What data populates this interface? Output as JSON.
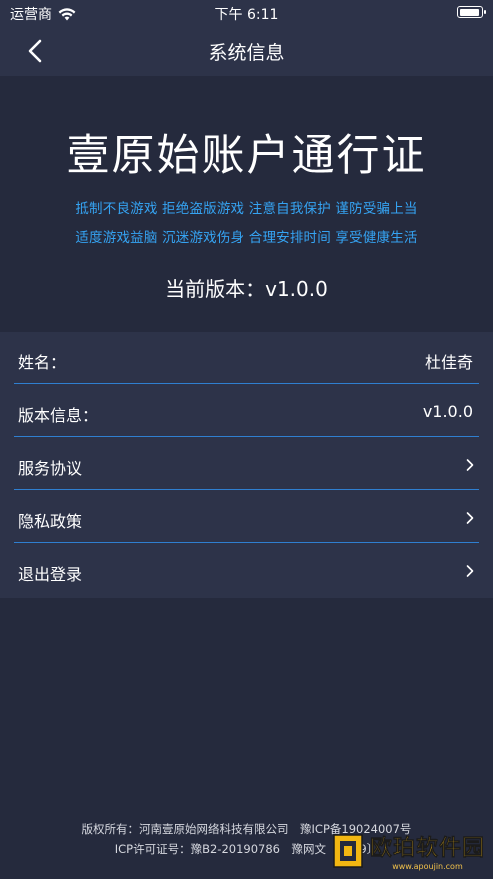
{
  "status_bar": {
    "carrier": "运营商",
    "time": "下午 6:11",
    "battery_level": 0.95
  },
  "nav": {
    "title": "系统信息",
    "back_icon": "chevron-left-icon"
  },
  "hero": {
    "title": "壹原始账户通行证",
    "notice_line1": "抵制不良游戏 拒绝盗版游戏 注意自我保护 谨防受骗上当",
    "notice_line2": "适度游戏益脑 沉迷游戏伤身 合理安排时间 享受健康生活",
    "version_text": "当前版本：v1.0.0"
  },
  "info_rows": [
    {
      "label": "姓名：",
      "value": "杜佳奇"
    },
    {
      "label": "版本信息：",
      "value": "v1.0.0"
    }
  ],
  "menu_rows": [
    {
      "label": "服务协议",
      "icon": "chevron-right-icon"
    },
    {
      "label": "隐私政策",
      "icon": "chevron-right-icon"
    },
    {
      "label": "退出登录",
      "icon": "chevron-right-icon"
    }
  ],
  "footer": {
    "line1": "版权所有：河南壹原始网络科技有限公司　豫ICP备19024007号",
    "line2": "ICP许可证号：豫B2-20190786　豫网文〔2019〕"
  },
  "watermark": {
    "main": "欧珀软件园",
    "sub": "www.apoujin.com"
  },
  "colors": {
    "background": "#252a3d",
    "panel": "#2d3349",
    "accent_blue": "#35a3f2",
    "divider": "#2f7fd0",
    "watermark_gold": "#f2b712"
  }
}
